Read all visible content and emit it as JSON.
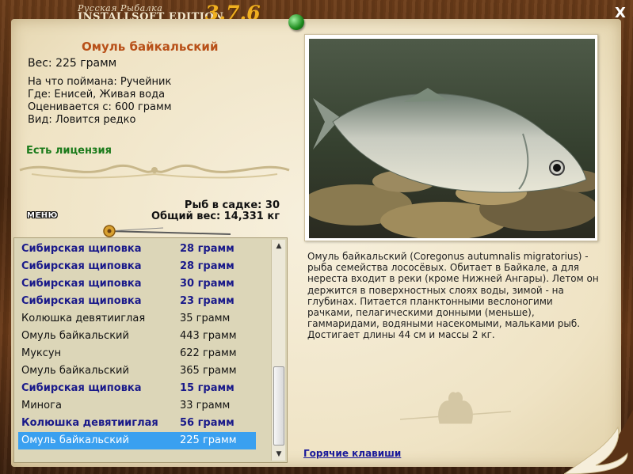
{
  "app": {
    "logo_top": "Русская Рыбалка",
    "logo_main": "INSTALLSOFT EDITION",
    "version": "3.7.6",
    "close_label": "X"
  },
  "fish": {
    "title": "Омуль байкальский",
    "weight": "Вес: 225 грамм",
    "caught_with": "На что поймана: Ручейник",
    "where": "Где: Енисей, Живая вода",
    "valued_from": "Оценивается с: 600 грамм",
    "kind": "Вид: Ловится редко",
    "license": "Есть лицензия",
    "description": "Омуль байкальский (Coregonus autumnalis migratorius) - рыба семейства лососёвых. Обитает в Байкале, а для нереста входит в реки (кроме Нижней Ангары). Летом он держится в поверхностных слоях воды, зимой - на глубинах. Питается планктонными веслоногими рачками, пелагическими донными (меньше), гаммаридами, водяными насекомыми, мальками рыб. Достигает длины 44 см и массы 2 кг."
  },
  "cage": {
    "count": "Рыб в садке: 30",
    "total": "Общий вес: 14,331 кг"
  },
  "menu_label": "МЕНЮ",
  "hotkeys_label": "Горячие клавиши",
  "catch_list": [
    {
      "name": "Сибирская щиповка",
      "weight": "28 грамм",
      "bold": true,
      "selected": false
    },
    {
      "name": "Сибирская щиповка",
      "weight": "28 грамм",
      "bold": true,
      "selected": false
    },
    {
      "name": "Сибирская щиповка",
      "weight": "30 грамм",
      "bold": true,
      "selected": false
    },
    {
      "name": "Сибирская щиповка",
      "weight": "23 грамм",
      "bold": true,
      "selected": false
    },
    {
      "name": "Колюшка девятииглая",
      "weight": "35 грамм",
      "bold": false,
      "selected": false
    },
    {
      "name": "Омуль байкальский",
      "weight": "443 грамм",
      "bold": false,
      "selected": false
    },
    {
      "name": "Муксун",
      "weight": "622 грамм",
      "bold": false,
      "selected": false
    },
    {
      "name": "Омуль байкальский",
      "weight": "365 грамм",
      "bold": false,
      "selected": false
    },
    {
      "name": "Сибирская щиповка",
      "weight": "15 грамм",
      "bold": true,
      "selected": false
    },
    {
      "name": "Минога",
      "weight": "33 грамм",
      "bold": false,
      "selected": false
    },
    {
      "name": "Колюшка девятииглая",
      "weight": "56 грамм",
      "bold": true,
      "selected": false
    },
    {
      "name": "Омуль байкальский",
      "weight": "225 грамм",
      "bold": false,
      "selected": true
    }
  ],
  "colors": {
    "title": "#b85018",
    "license": "#1a7a1a",
    "bold_row": "#1a1a8a",
    "selected_row": "#3aa0f0"
  }
}
